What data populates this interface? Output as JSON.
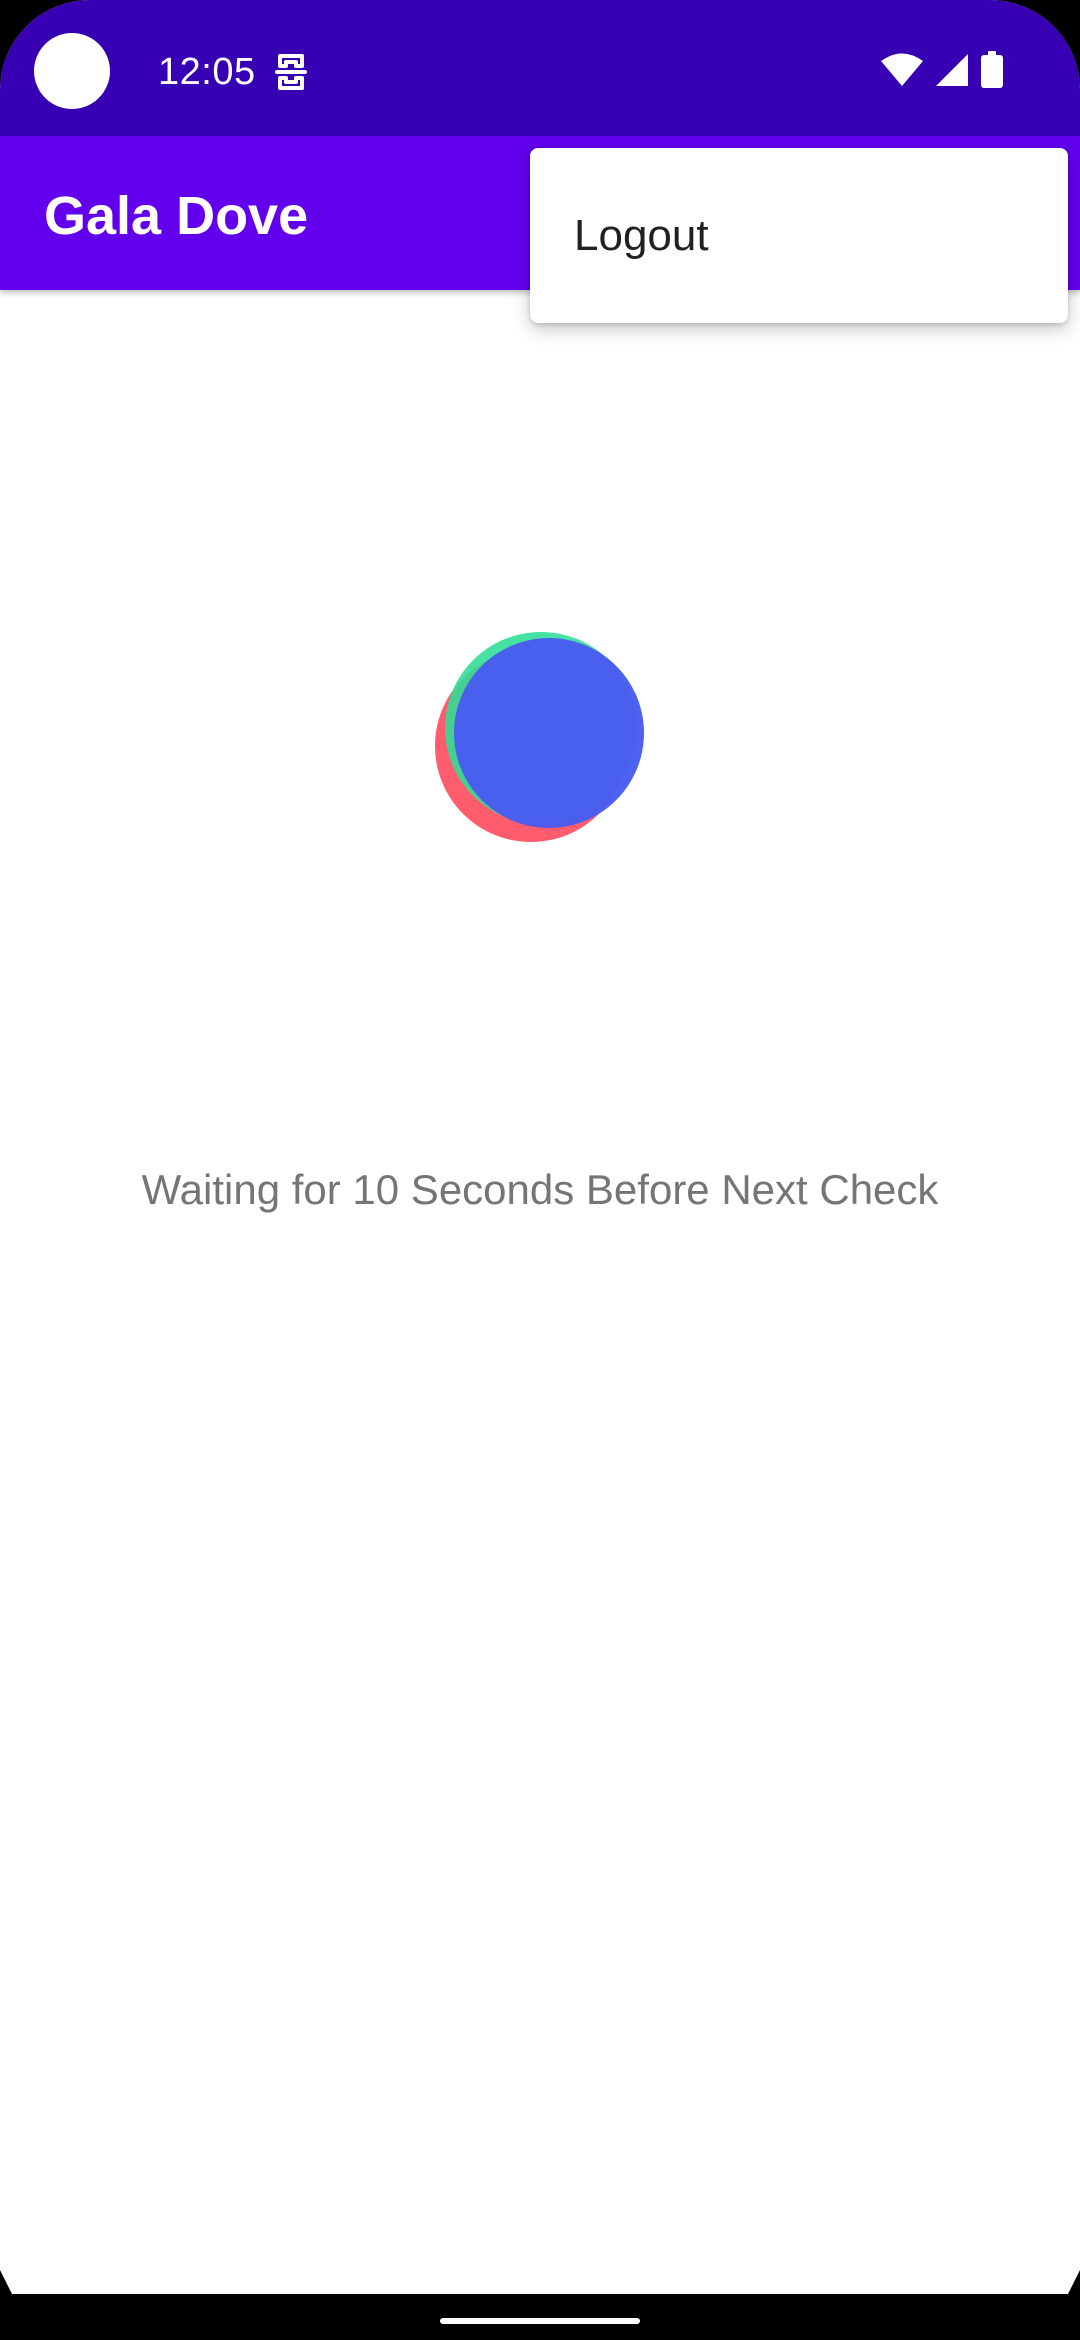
{
  "status_bar": {
    "time": "12:05",
    "notification_icon": "notification-glyph-icon",
    "wifi_icon": "wifi-icon",
    "signal_icon": "cell-signal-icon",
    "battery_icon": "battery-icon",
    "background_color": "#3700b3"
  },
  "app_bar": {
    "title": "Gala Dove",
    "background_color": "#6200ee"
  },
  "overflow_menu": {
    "items": [
      {
        "label": "Logout"
      }
    ]
  },
  "main": {
    "loader_icon": "loading-spinner-icon",
    "loader_colors": [
      "#ff465a",
      "#2ede96",
      "#485cf0"
    ],
    "status_message": "Waiting for 10 Seconds Before Next Check"
  }
}
